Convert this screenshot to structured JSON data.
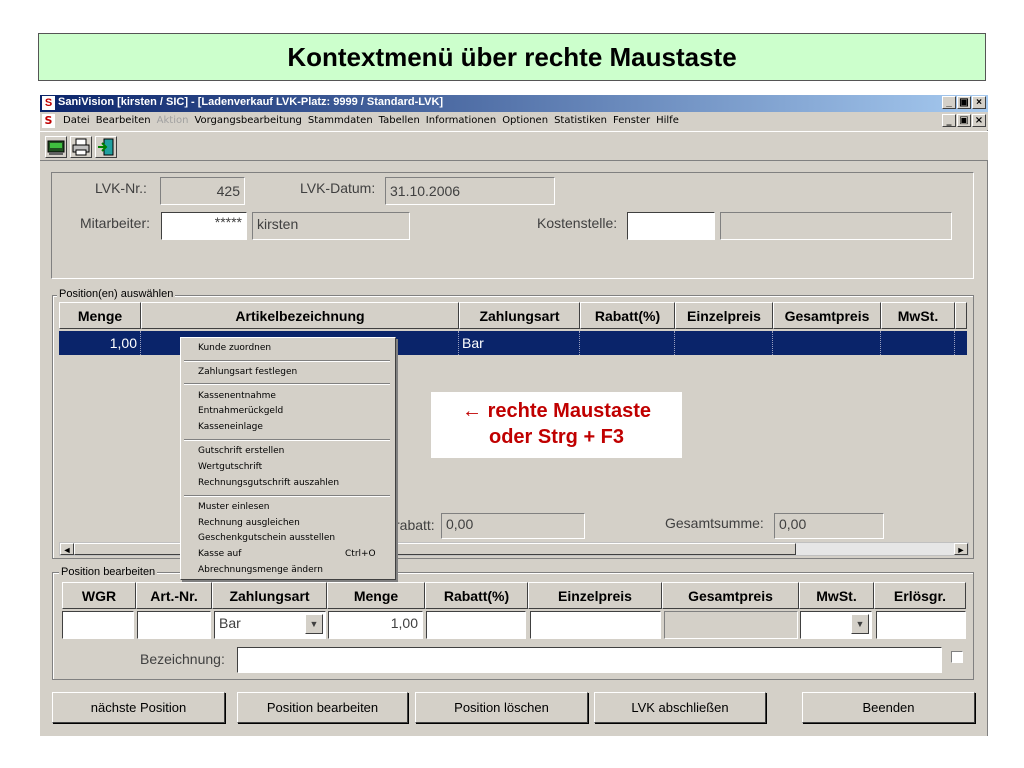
{
  "slide": {
    "title": "Kontextmenü über rechte Maustaste"
  },
  "window": {
    "title": "SaniVision [kirsten / SIC] - [Ladenverkauf LVK-Platz: 9999 / Standard-LVK]",
    "icon_text": "S",
    "btn_min": "_",
    "btn_restore": "▣",
    "btn_close": "×"
  },
  "menu": {
    "items": [
      "Datei",
      "Bearbeiten",
      "Aktion",
      "Vorgangsbearbeitung",
      "Stammdaten",
      "Tabellen",
      "Informationen",
      "Optionen",
      "Statistiken",
      "Fenster",
      "Hilfe"
    ]
  },
  "header": {
    "lvk_nr_label": "LVK-Nr.:",
    "lvk_nr_value": "425",
    "lvk_datum_label": "LVK-Datum:",
    "lvk_datum_value": "31.10.2006",
    "mitarbeiter_label": "Mitarbeiter:",
    "mitarbeiter_pw": "*****",
    "mitarbeiter_name": "kirsten",
    "kostenstelle_label": "Kostenstelle:",
    "kostenstelle_value": "",
    "kostenstelle_desc": ""
  },
  "positions": {
    "legend": "Position(en) auswählen",
    "columns": [
      "Menge",
      "Artikelbezeichnung",
      "Zahlungsart",
      "Rabatt(%)",
      "Einzelpreis",
      "Gesamtpreis",
      "MwSt."
    ],
    "row": {
      "menge": "1,00",
      "artikel": "",
      "zahlungsart": "Bar",
      "rabatt": "",
      "einzelpreis": "",
      "gesamtpreis": "",
      "mwst": ""
    },
    "rabatt_label": "rabatt:",
    "rabatt_value": "0,00",
    "gesamtsumme_label": "Gesamtsumme:",
    "gesamtsumme_value": "0,00"
  },
  "context_menu": {
    "items": [
      "Kunde zuordnen",
      "Zahlungsart festlegen",
      "Kassenentnahme",
      "Entnahmerückgeld",
      "Kasseneinlage",
      "Gutschrift erstellen",
      "Wertgutschrift",
      "Rechnungsgutschrift auszahlen",
      "Muster einlesen",
      "Rechnung ausgleichen",
      "Geschenkgutschein ausstellen",
      "Kasse auf",
      "Abrechnungsmenge ändern"
    ],
    "shortcut_kasse_auf": "Ctrl+O"
  },
  "callout": {
    "line1": "← rechte Maustaste",
    "line2": "oder Strg + F3"
  },
  "edit": {
    "legend": "Position bearbeiten",
    "columns": [
      "WGR",
      "Art.-Nr.",
      "Zahlungsart",
      "Menge",
      "Rabatt(%)",
      "Einzelpreis",
      "Gesamtpreis",
      "MwSt.",
      "Erlösgr."
    ],
    "zahlungsart_value": "Bar",
    "menge_value": "1,00",
    "bezeichnung_label": "Bezeichnung:",
    "bezeichnung_value": ""
  },
  "buttons": {
    "naechste": "nächste Position",
    "bearbeiten": "Position bearbeiten",
    "loeschen": "Position löschen",
    "abschliessen": "LVK abschließen",
    "beenden": "Beenden"
  },
  "scroll": {
    "left": "◄",
    "right": "►",
    "down": "▼"
  },
  "colors": {
    "selection": "#0a246a",
    "callout_text": "#c00000",
    "title_bg": "#ccffcc"
  }
}
